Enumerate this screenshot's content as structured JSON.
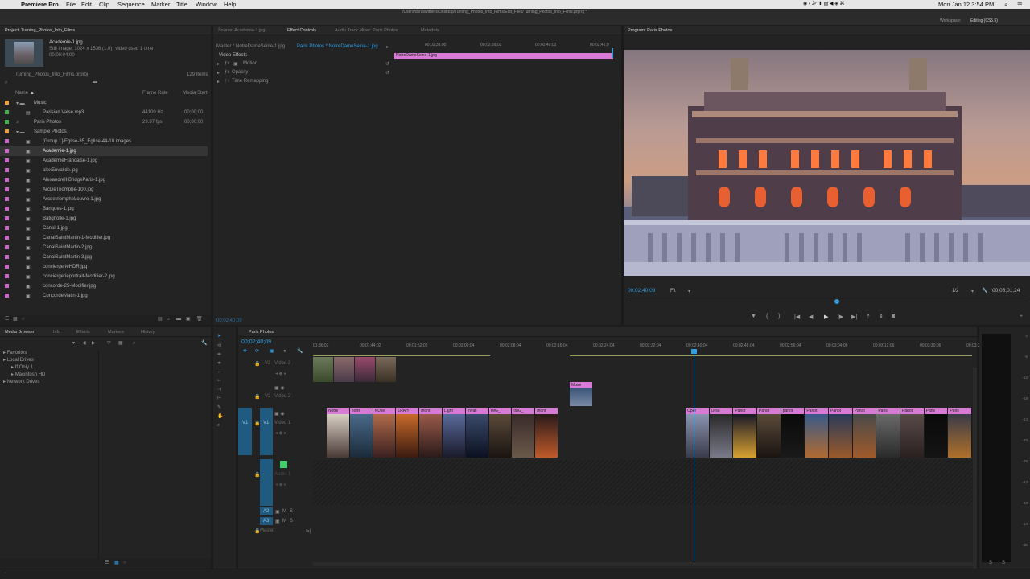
{
  "menubar": {
    "apple": "",
    "app": "Premiere Pro",
    "items": [
      "File",
      "Edit",
      "Clip",
      "Sequence",
      "Marker",
      "Title",
      "Window",
      "Help"
    ],
    "path": "/Users/dsruswithers/Desktop/Turning_Photos_Into_Films/Edit_Files/Turning_Photos_Into_Films.prproj *",
    "clock": "Mon Jan 12  3:54 PM",
    "user": "2"
  },
  "workspace": {
    "label": "Workspace:",
    "value": "Editing (CS5.5)"
  },
  "project": {
    "tab": "Project: Turning_Photos_Into_Films",
    "media_name": "Academie-1.jpg",
    "media_info1": "Still Image, 1024 x 1536 (1.0)",
    "media_info2": ", video used 1 time",
    "media_duration": "00:00:04:00",
    "proj_file": "Turning_Photos_Into_Films.prproj",
    "items_count": "129 Items",
    "col_name": "Name",
    "col_fps": "Frame Rate",
    "col_start": "Media Start",
    "items": [
      {
        "name": "Music",
        "type": "folder",
        "indent": 1,
        "color": "#e8a33a"
      },
      {
        "name": "Parisian Valse.mp3",
        "type": "audio",
        "indent": 2,
        "color": "#3fb24a",
        "fps": "44100 Hz",
        "start": "00;00;00"
      },
      {
        "name": "Paris Photos",
        "type": "seq",
        "indent": 1,
        "color": "#3fb24a",
        "fps": "29.97 fps",
        "start": "00;00;00"
      },
      {
        "name": "Sample Photos",
        "type": "folder",
        "indent": 1,
        "color": "#e8a33a"
      },
      {
        "name": "[Group 1]-Eglise-35_Eglise-44-10 images",
        "type": "img",
        "indent": 2,
        "color": "#c968c8"
      },
      {
        "name": "Academie-1.jpg",
        "type": "img",
        "indent": 2,
        "color": "#c968c8",
        "selected": true
      },
      {
        "name": "AcademieFrancaise-1.jpg",
        "type": "img",
        "indent": 2,
        "color": "#c968c8"
      },
      {
        "name": "alexEnvalide.jpg",
        "type": "img",
        "indent": 2,
        "color": "#c968c8"
      },
      {
        "name": "AlexandreIIIBridgeParis-1.jpg",
        "type": "img",
        "indent": 2,
        "color": "#c968c8"
      },
      {
        "name": "ArcDeTriomphe-100.jpg",
        "type": "img",
        "indent": 2,
        "color": "#c968c8"
      },
      {
        "name": "ArcdetriompheLouvre-1.jpg",
        "type": "img",
        "indent": 2,
        "color": "#c968c8"
      },
      {
        "name": "Banques-1.jpg",
        "type": "img",
        "indent": 2,
        "color": "#c968c8"
      },
      {
        "name": "Batignolle-1.jpg",
        "type": "img",
        "indent": 2,
        "color": "#c968c8"
      },
      {
        "name": "Canal-1.jpg",
        "type": "img",
        "indent": 2,
        "color": "#c968c8"
      },
      {
        "name": "CanalSaintMartin-1-Modifier.jpg",
        "type": "img",
        "indent": 2,
        "color": "#c968c8"
      },
      {
        "name": "CanalSaintMartin-2.jpg",
        "type": "img",
        "indent": 2,
        "color": "#c968c8"
      },
      {
        "name": "CanalSaintMartin-3.jpg",
        "type": "img",
        "indent": 2,
        "color": "#c968c8"
      },
      {
        "name": "conciergerieHDR.jpg",
        "type": "img",
        "indent": 2,
        "color": "#c968c8"
      },
      {
        "name": "conciergerieportrait-Modifier-2.jpg",
        "type": "img",
        "indent": 2,
        "color": "#c968c8"
      },
      {
        "name": "concorde-25-Modifier.jpg",
        "type": "img",
        "indent": 2,
        "color": "#c968c8"
      },
      {
        "name": "ConcordeMatin-1.jpg",
        "type": "img",
        "indent": 2,
        "color": "#c968c8"
      }
    ]
  },
  "source_tabs": [
    "Source: Academie-1.jpg",
    "Effect Controls",
    "Audio Track Mixer: Paris Photos",
    "Metadata"
  ],
  "effect_controls": {
    "master": "Master * NotreDameSeine-1.jpg",
    "clip": "Paris Photos * NotreDameSeine-1.jpg",
    "section": "Video Effects",
    "effects": [
      "Motion",
      "Opacity",
      "Time Remapping"
    ],
    "ruler": [
      "00;02;38;00",
      "00;02;39;02",
      "00;02;40;02",
      "00;02;41;0"
    ],
    "clip_bar": "NotreDameSeine-1.jpg",
    "timecode": "00;02;40;09"
  },
  "program": {
    "tab": "Program: Paris Photos",
    "timecode": "00;02;40;09",
    "fit": "Fit",
    "ratio": "1/2",
    "duration": "00;05;01;24"
  },
  "bottom_left": {
    "tabs": [
      "Media Browser",
      "Info",
      "Effects",
      "Markers",
      "History"
    ],
    "tree": [
      {
        "label": "Favorites",
        "indent": 0
      },
      {
        "label": "Local Drives",
        "indent": 0
      },
      {
        "label": "If Only 1",
        "indent": 1
      },
      {
        "label": "Macintosh HD",
        "indent": 1
      },
      {
        "label": "Network Drives",
        "indent": 0
      }
    ]
  },
  "timeline": {
    "tab": "Paris Photos",
    "timecode": "00;02;40;09",
    "ruler": [
      "01;36;02",
      "00;01;44;02",
      "00;01;52;02",
      "00;02;00;04",
      "00;02;08;04",
      "00;02;16;04",
      "00;02;24;04",
      "00;02;32;04",
      "00;02;40;04",
      "00;02;48;04",
      "00;02;56;04",
      "00;03;04;06",
      "00;03;12;06",
      "00;03;20;06",
      "00;03;28;0"
    ],
    "tracks": {
      "v3": "V3",
      "v3name": "Video 3",
      "v2": "V2",
      "v2name": "Video 2",
      "v1": "V1",
      "v1name": "Video 1",
      "v1src": "V1",
      "a1": "A1",
      "a1name": "Audio 1",
      "a2": "A2",
      "a3": "A3",
      "master": "Master",
      "m": "M",
      "s": "S"
    },
    "v1_labels_left": [
      "Notre",
      "notre",
      "NDse",
      "LRAH",
      "mont",
      "Light",
      "Invali",
      "IMG_",
      "IMG_",
      "mont"
    ],
    "v1_labels_right": [
      "Oper",
      "Orsa",
      "Panot",
      "Panot",
      "panot",
      "Panot",
      "Panot",
      "Panot",
      "Paris",
      "Panot",
      "Paris",
      "Paris"
    ],
    "v2_label": "Muse"
  },
  "meter": {
    "scale": [
      "0",
      "-6",
      "-12",
      "-18",
      "-24",
      "-30",
      "-36",
      "-42",
      "-48",
      "-54",
      "dB"
    ],
    "footer": [
      "S",
      "S"
    ]
  },
  "colors": {
    "accent": "#2f9de0",
    "clip": "#d77bd6",
    "selection": "#1f5a80"
  }
}
